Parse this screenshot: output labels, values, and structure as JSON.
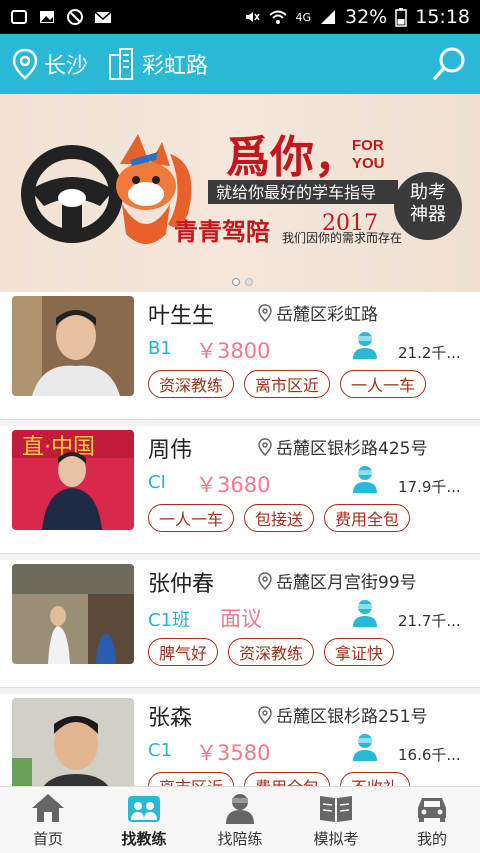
{
  "status_bar": {
    "battery": "32%",
    "time": "15:18",
    "network": "4G"
  },
  "header": {
    "city": "长沙",
    "road": "彩虹路"
  },
  "banner": {
    "title": "爲你，",
    "for_you": "FOR\nYOU",
    "slogan": "就给你最好的学车指导",
    "year": "2017",
    "brand": "青青驾陪",
    "tagline": "我们因你的需求而存在",
    "badge_line1": "助考",
    "badge_line2": "神器"
  },
  "coaches": [
    {
      "name": "叶生生",
      "address": "岳麓区彩虹路",
      "license": "B1",
      "price": "￥3800",
      "distance": "21.2千...",
      "tags": [
        "资深教练",
        "离市区近",
        "一人一车"
      ]
    },
    {
      "name": "周伟",
      "address": "岳麓区银杉路425号",
      "license": "CI",
      "price": "￥3680",
      "distance": "17.9千...",
      "tags": [
        "一人一车",
        "包接送",
        "费用全包"
      ]
    },
    {
      "name": "张仲春",
      "address": "岳麓区月宫街99号",
      "license": "C1班",
      "price": "面议",
      "distance": "21.7千...",
      "tags": [
        "脾气好",
        "资深教练",
        "拿证快"
      ]
    },
    {
      "name": "张森",
      "address": "岳麓区银杉路251号",
      "license": "C1",
      "price": "￥3580",
      "distance": "16.6千...",
      "tags": [
        "离市区近",
        "费用全包",
        "不收礼"
      ]
    }
  ],
  "nav": [
    {
      "label": "首页",
      "icon": "home-icon"
    },
    {
      "label": "找教练",
      "icon": "find-coach-icon"
    },
    {
      "label": "找陪练",
      "icon": "find-partner-icon"
    },
    {
      "label": "模拟考",
      "icon": "mock-exam-icon"
    },
    {
      "label": "我的",
      "icon": "my-car-icon"
    }
  ],
  "colors": {
    "accent": "#29b9d6",
    "price": "#f27a8c",
    "tag": "#a4311c"
  }
}
